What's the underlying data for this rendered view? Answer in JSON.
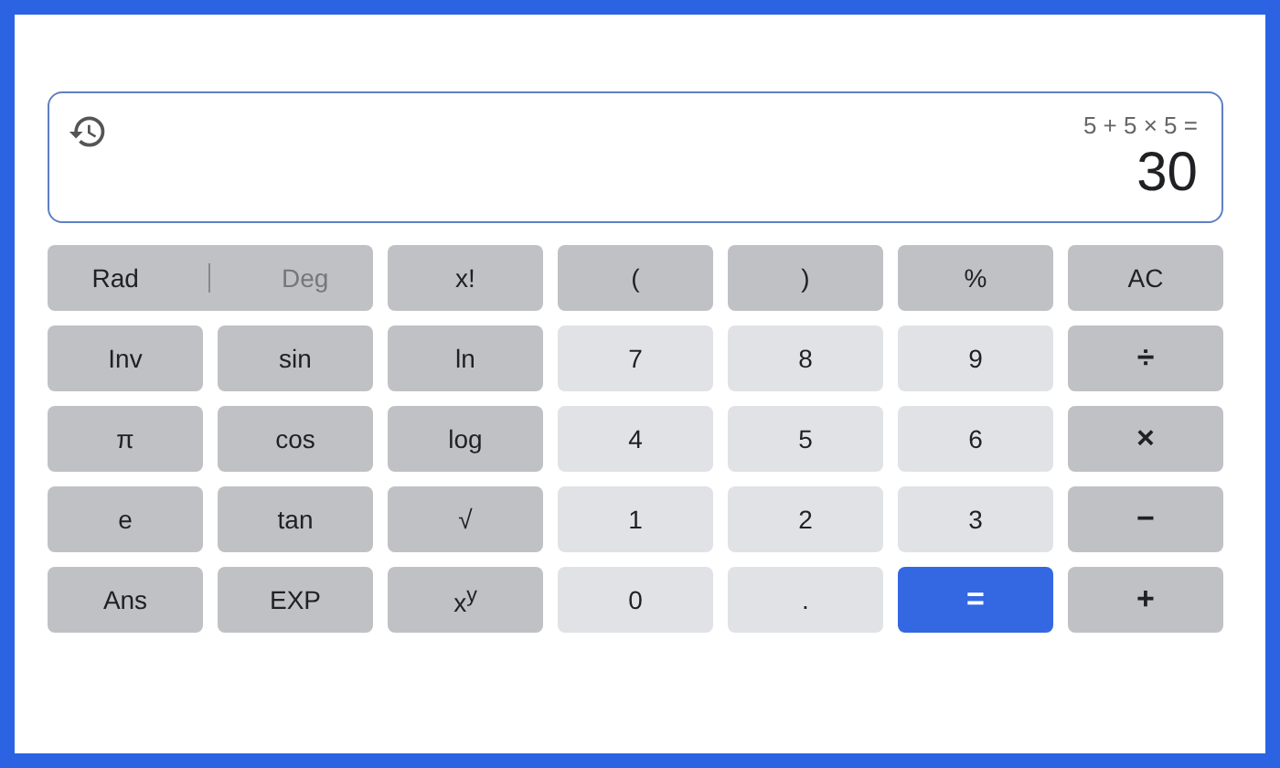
{
  "display": {
    "expression": "5 + 5 × 5 =",
    "result": "30"
  },
  "keys": [
    {
      "kind": "mode",
      "options": [
        {
          "label": "Rad",
          "selected": true
        },
        {
          "label": "Deg",
          "selected": false
        }
      ]
    },
    {
      "kind": "func",
      "label": "x!"
    },
    {
      "kind": "func",
      "label": "("
    },
    {
      "kind": "func",
      "label": ")"
    },
    {
      "kind": "func",
      "label": "%"
    },
    {
      "kind": "func",
      "label": "AC"
    },
    {
      "kind": "func",
      "label": "Inv"
    },
    {
      "kind": "func",
      "label": "sin"
    },
    {
      "kind": "func",
      "label": "ln"
    },
    {
      "kind": "digit",
      "label": "7"
    },
    {
      "kind": "digit",
      "label": "8"
    },
    {
      "kind": "digit",
      "label": "9"
    },
    {
      "kind": "op",
      "label": "÷"
    },
    {
      "kind": "func",
      "label": "π"
    },
    {
      "kind": "func",
      "label": "cos"
    },
    {
      "kind": "func",
      "label": "log"
    },
    {
      "kind": "digit",
      "label": "4"
    },
    {
      "kind": "digit",
      "label": "5"
    },
    {
      "kind": "digit",
      "label": "6"
    },
    {
      "kind": "op",
      "label": "×"
    },
    {
      "kind": "func",
      "label": "e"
    },
    {
      "kind": "func",
      "label": "tan"
    },
    {
      "kind": "func",
      "label": "√"
    },
    {
      "kind": "digit",
      "label": "1"
    },
    {
      "kind": "digit",
      "label": "2"
    },
    {
      "kind": "digit",
      "label": "3"
    },
    {
      "kind": "op",
      "label": "−"
    },
    {
      "kind": "func",
      "label": "Ans"
    },
    {
      "kind": "func",
      "label": "EXP"
    },
    {
      "kind": "func",
      "label": "x$^{y}$"
    },
    {
      "kind": "digit",
      "label": "0"
    },
    {
      "kind": "digit",
      "label": "."
    },
    {
      "kind": "equals",
      "label": "="
    },
    {
      "kind": "op",
      "label": "+"
    }
  ]
}
